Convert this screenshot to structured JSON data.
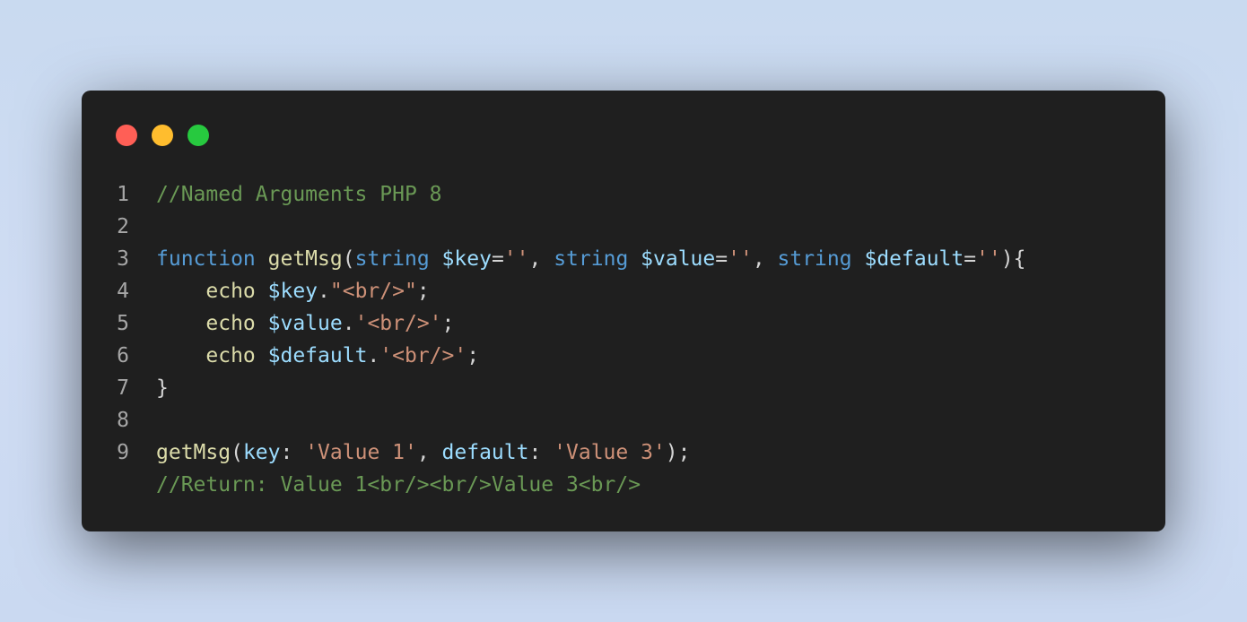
{
  "colors": {
    "background": "#c9daf0",
    "window": "#1f1f1f",
    "dot_red": "#ff5f56",
    "dot_yellow": "#ffbd2e",
    "dot_green": "#27c93f",
    "comment": "#6a9955",
    "keyword": "#569cd6",
    "function": "#dcdcaa",
    "variable": "#9cdcfe",
    "string": "#ce9178",
    "punctuation": "#d4d4d4",
    "line_number": "#a6a6a6"
  },
  "window_controls": [
    "close-dot",
    "minimize-dot",
    "maximize-dot"
  ],
  "code": {
    "lines": [
      {
        "number": "1",
        "tokens": [
          {
            "text": "//Named Arguments PHP 8",
            "kind": "comment"
          }
        ]
      },
      {
        "number": "2",
        "tokens": []
      },
      {
        "number": "3",
        "tokens": [
          {
            "text": "function",
            "kind": "keyword"
          },
          {
            "text": " ",
            "kind": "punc"
          },
          {
            "text": "getMsg",
            "kind": "func"
          },
          {
            "text": "(",
            "kind": "punc"
          },
          {
            "text": "string",
            "kind": "type"
          },
          {
            "text": " ",
            "kind": "punc"
          },
          {
            "text": "$key",
            "kind": "var"
          },
          {
            "text": "=",
            "kind": "punc"
          },
          {
            "text": "''",
            "kind": "str"
          },
          {
            "text": ", ",
            "kind": "punc"
          },
          {
            "text": "string",
            "kind": "type"
          },
          {
            "text": " ",
            "kind": "punc"
          },
          {
            "text": "$value",
            "kind": "var"
          },
          {
            "text": "=",
            "kind": "punc"
          },
          {
            "text": "''",
            "kind": "str"
          },
          {
            "text": ", ",
            "kind": "punc"
          },
          {
            "text": "string",
            "kind": "type"
          },
          {
            "text": " ",
            "kind": "punc"
          },
          {
            "text": "$default",
            "kind": "var"
          },
          {
            "text": "=",
            "kind": "punc"
          },
          {
            "text": "''",
            "kind": "str"
          },
          {
            "text": "){",
            "kind": "punc"
          }
        ]
      },
      {
        "number": "4",
        "tokens": [
          {
            "text": "    ",
            "kind": "punc"
          },
          {
            "text": "echo",
            "kind": "echo"
          },
          {
            "text": " ",
            "kind": "punc"
          },
          {
            "text": "$key",
            "kind": "var"
          },
          {
            "text": ".",
            "kind": "punc"
          },
          {
            "text": "\"<br/>\"",
            "kind": "str"
          },
          {
            "text": ";",
            "kind": "punc"
          }
        ]
      },
      {
        "number": "5",
        "tokens": [
          {
            "text": "    ",
            "kind": "punc"
          },
          {
            "text": "echo",
            "kind": "echo"
          },
          {
            "text": " ",
            "kind": "punc"
          },
          {
            "text": "$value",
            "kind": "var"
          },
          {
            "text": ".",
            "kind": "punc"
          },
          {
            "text": "'<br/>'",
            "kind": "str"
          },
          {
            "text": ";",
            "kind": "punc"
          }
        ]
      },
      {
        "number": "6",
        "tokens": [
          {
            "text": "    ",
            "kind": "punc"
          },
          {
            "text": "echo",
            "kind": "echo"
          },
          {
            "text": " ",
            "kind": "punc"
          },
          {
            "text": "$default",
            "kind": "var"
          },
          {
            "text": ".",
            "kind": "punc"
          },
          {
            "text": "'<br/>'",
            "kind": "str"
          },
          {
            "text": ";",
            "kind": "punc"
          }
        ]
      },
      {
        "number": "7",
        "tokens": [
          {
            "text": "}",
            "kind": "punc"
          }
        ]
      },
      {
        "number": "8",
        "tokens": []
      },
      {
        "number": "9",
        "tokens": [
          {
            "text": "getMsg",
            "kind": "func"
          },
          {
            "text": "(",
            "kind": "punc"
          },
          {
            "text": "key",
            "kind": "var"
          },
          {
            "text": ": ",
            "kind": "punc"
          },
          {
            "text": "'Value 1'",
            "kind": "str"
          },
          {
            "text": ", ",
            "kind": "punc"
          },
          {
            "text": "default",
            "kind": "var"
          },
          {
            "text": ": ",
            "kind": "punc"
          },
          {
            "text": "'Value 3'",
            "kind": "str"
          },
          {
            "text": ");",
            "kind": "punc"
          }
        ]
      },
      {
        "number": "",
        "tokens": [
          {
            "text": "//Return: Value 1<br/><br/>Value 3<br/>",
            "kind": "comment"
          }
        ]
      }
    ]
  }
}
